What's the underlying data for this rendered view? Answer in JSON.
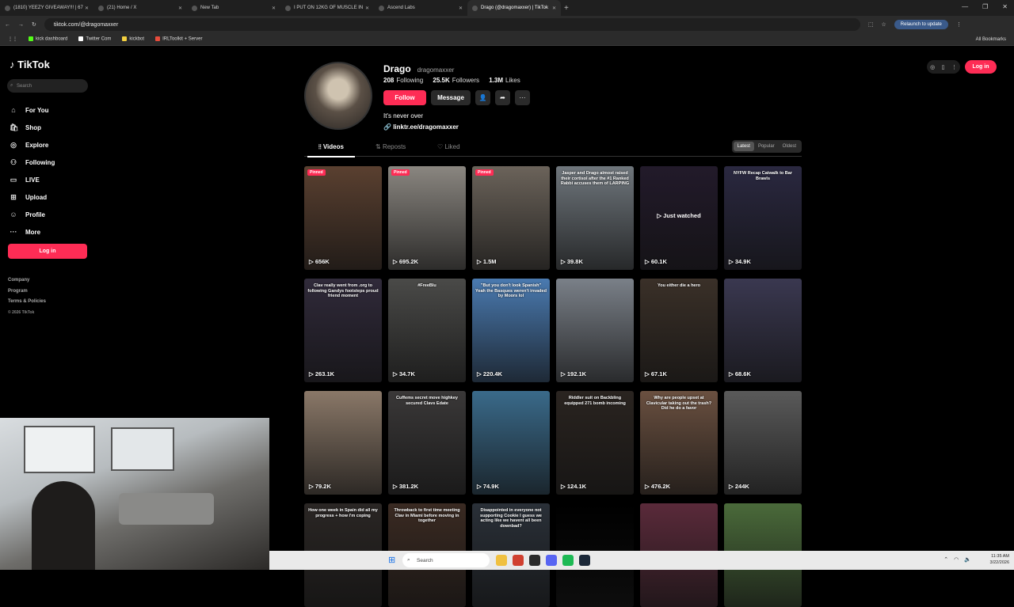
{
  "browser": {
    "tabs": [
      {
        "title": "(1810) YEEZY GIVEAWAY!!! | 67"
      },
      {
        "title": "(21) Home / X"
      },
      {
        "title": "New Tab"
      },
      {
        "title": "I PUT ON 12KG OF MUSCLE IN"
      },
      {
        "title": "Ascend Labs"
      },
      {
        "title": "Drago (@dragomaxxer) | TikTok"
      }
    ],
    "url": "tiktok.com/@dragomaxxer",
    "relaunch": "Relaunch to update",
    "bookmarks": [
      "kick dashboard",
      "Twitter Com",
      "kickbot",
      "IRLToolkit + Server"
    ],
    "all_bookmarks": "All Bookmarks"
  },
  "sidebar": {
    "logo": "TikTok",
    "search_placeholder": "Search",
    "nav": [
      {
        "label": "For You",
        "icon": "home-icon"
      },
      {
        "label": "Shop",
        "icon": "shop-icon"
      },
      {
        "label": "Explore",
        "icon": "compass-icon"
      },
      {
        "label": "Following",
        "icon": "following-icon"
      },
      {
        "label": "LIVE",
        "icon": "live-icon"
      },
      {
        "label": "Upload",
        "icon": "upload-icon"
      },
      {
        "label": "Profile",
        "icon": "profile-icon"
      },
      {
        "label": "More",
        "icon": "more-icon"
      }
    ],
    "login": "Log in",
    "footer": [
      "Company",
      "Program",
      "Terms & Policies"
    ],
    "copyright": "© 2026 TikTok"
  },
  "profile": {
    "name": "Drago",
    "handle": "dragomaxxer",
    "following_count": "208",
    "following_label": "Following",
    "followers_count": "25.5K",
    "followers_label": "Followers",
    "likes_count": "1.3M",
    "likes_label": "Likes",
    "follow": "Follow",
    "message": "Message",
    "bio": "It's never over",
    "link": "linktr.ee/dragomaxxer"
  },
  "tabs": {
    "videos": "Videos",
    "reposts": "Reposts",
    "liked": "Liked"
  },
  "sort": {
    "latest": "Latest",
    "popular": "Popular",
    "oldest": "Oldest"
  },
  "topbar": {
    "login": "Log in"
  },
  "videos": [
    {
      "views": "656K",
      "pinned": "Pinned",
      "caption": "",
      "bg": "#5a4030"
    },
    {
      "views": "695.2K",
      "pinned": "Pinned",
      "caption": "",
      "bg": "#8a8680"
    },
    {
      "views": "1.5M",
      "pinned": "Pinned",
      "caption": "",
      "bg": "#6b635a"
    },
    {
      "views": "39.8K",
      "pinned": "",
      "caption": "Jasper and Drago almost raised their cortisol after the #1 Ranked Rabbi accuses them of LARPING",
      "bg": "#6f767c"
    },
    {
      "views": "60.1K",
      "pinned": "",
      "caption": "",
      "bg": "#221a2a",
      "watched": "Just watched"
    },
    {
      "views": "34.9K",
      "pinned": "",
      "caption": "NYFW Recap Catwalk to Bar Brawls",
      "bg": "#2a2840"
    },
    {
      "views": "263.1K",
      "pinned": "",
      "caption": "Clav really went from .org to following Gandys footsteps proud friend moment",
      "bg": "#302a3a"
    },
    {
      "views": "34.7K",
      "pinned": "",
      "caption": "#FreeBlu",
      "bg": "#4a4a48"
    },
    {
      "views": "220.4K",
      "pinned": "",
      "caption": "\"But you don't look Spanish\" Yeah the Basques weren't invaded by Moors lol",
      "bg": "#4a7ab0"
    },
    {
      "views": "192.1K",
      "pinned": "",
      "caption": "",
      "bg": "#7a8088"
    },
    {
      "views": "67.1K",
      "pinned": "",
      "caption": "You either die a hero",
      "bg": "#3a3028"
    },
    {
      "views": "68.6K",
      "pinned": "",
      "caption": "",
      "bg": "#3a3850"
    },
    {
      "views": "79.2K",
      "pinned": "",
      "caption": "",
      "bg": "#8a7868"
    },
    {
      "views": "381.2K",
      "pinned": "",
      "caption": "Cuffems secret move highkey secured Clavs Edate",
      "bg": "#3a3838"
    },
    {
      "views": "74.9K",
      "pinned": "",
      "caption": "",
      "bg": "#3a6a8a"
    },
    {
      "views": "124.1K",
      "pinned": "",
      "caption": "Riddler suit on Backbling equipped 271 bomb incoming",
      "bg": "#2a2420"
    },
    {
      "views": "476.2K",
      "pinned": "",
      "caption": "Why are people upset at Clavicular taking out the trash? Did he do a favor",
      "bg": "#6a5040"
    },
    {
      "views": "244K",
      "pinned": "",
      "caption": "",
      "bg": "#5a5a5a"
    },
    {
      "views": "",
      "pinned": "",
      "caption": "How one week in Spain did all my progress + how i'm coping",
      "bg": "#2a2624"
    },
    {
      "views": "",
      "pinned": "",
      "caption": "Throwback to first time meeting Clav in Miami before moving in together",
      "bg": "#3a2a22"
    },
    {
      "views": "",
      "pinned": "",
      "caption": "Disappointed in everyone not supporting Cookie I guess we acting like we havent all been downbad?",
      "bg": "#2a3038"
    },
    {
      "views": "",
      "pinned": "",
      "caption": "",
      "bg": "#000000"
    },
    {
      "views": "",
      "pinned": "",
      "caption": "",
      "bg": "#5a2a3a"
    },
    {
      "views": "",
      "pinned": "",
      "caption": "",
      "bg": "#4a6a3a"
    }
  ],
  "taskbar": {
    "search": "Search",
    "time": "11:35 AM",
    "date": "3/22/2026"
  }
}
